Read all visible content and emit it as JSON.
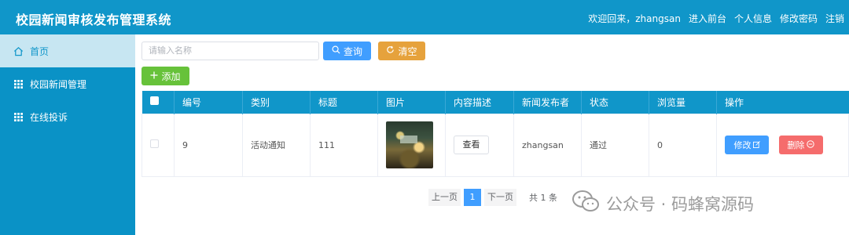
{
  "header": {
    "title": "校园新闻审核发布管理系统",
    "welcome": "欢迎回来，zhangsan",
    "nav": [
      "进入前台",
      "个人信息",
      "修改密码",
      "注销"
    ]
  },
  "sidebar": {
    "items": [
      {
        "label": "首页",
        "icon": "home-icon"
      },
      {
        "label": "校园新闻管理",
        "icon": "grid-icon"
      },
      {
        "label": "在线投诉",
        "icon": "grid-icon"
      }
    ]
  },
  "toolbar": {
    "search_placeholder": "请输入名称",
    "search_label": "查询",
    "clear_label": "清空",
    "add_label": "添加"
  },
  "table": {
    "columns": [
      "编号",
      "类别",
      "标题",
      "图片",
      "内容描述",
      "新闻发布者",
      "状态",
      "浏览量",
      "操作"
    ],
    "rows": [
      {
        "id": "9",
        "category": "活动通知",
        "title": "111",
        "view_label": "查看",
        "publisher": "zhangsan",
        "status": "通过",
        "views": "0",
        "edit_label": "修改",
        "delete_label": "删除"
      }
    ]
  },
  "pagination": {
    "prev": "上一页",
    "current": "1",
    "next": "下一页",
    "total": "共 1 条"
  },
  "watermark": {
    "text": "公众号 · 码蜂窝源码"
  },
  "colors": {
    "primary": "#1096c9",
    "blue": "#409eff",
    "orange": "#e6a23c",
    "green": "#67c23a",
    "red": "#f56c6c"
  }
}
